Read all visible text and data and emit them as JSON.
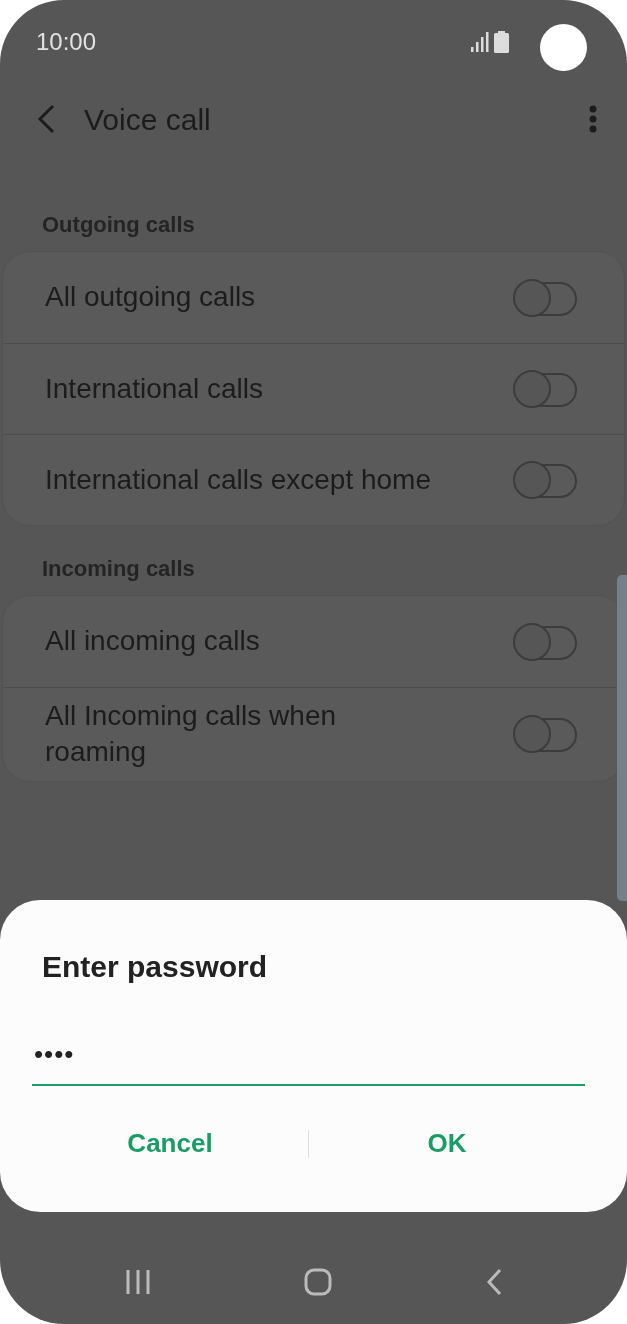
{
  "status_bar": {
    "time": "10:00"
  },
  "header": {
    "title": "Voice call"
  },
  "sections": [
    {
      "title": "Outgoing calls",
      "items": [
        {
          "label": "All outgoing calls",
          "on": false
        },
        {
          "label": "International calls",
          "on": false
        },
        {
          "label": "International calls except home",
          "on": false
        }
      ]
    },
    {
      "title": "Incoming calls",
      "items": [
        {
          "label": "All incoming calls",
          "on": false
        },
        {
          "label": "All Incoming calls when roaming",
          "on": false
        }
      ]
    }
  ],
  "dialog": {
    "title": "Enter password",
    "password": "••••",
    "buttons": [
      "Cancel",
      "OK"
    ]
  }
}
